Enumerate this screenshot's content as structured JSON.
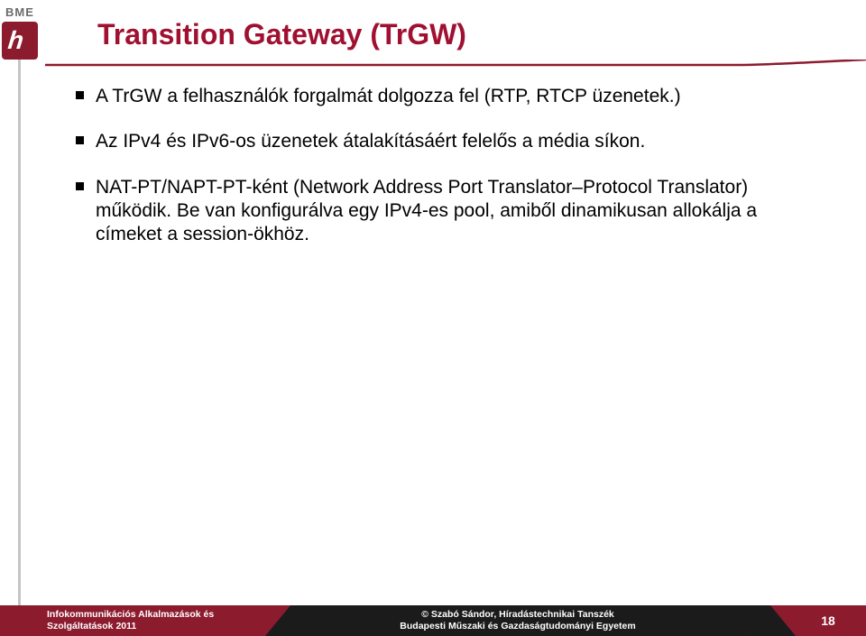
{
  "brand": {
    "rail_text": "BME",
    "rail_glyph": "h"
  },
  "title": "Transition Gateway (TrGW)",
  "bullets": [
    "A TrGW a felhasználók forgalmát dolgozza fel (RTP, RTCP üzenetek.)",
    "Az IPv4 és IPv6-os üzenetek átalakításáért felelős a média síkon.",
    "NAT-PT/NAPT-PT-ként (Network Address Port Translator–Protocol Translator) működik. Be van konfigurálva egy IPv4-es pool, amiből dinamikusan allokálja a címeket a session-ökhöz."
  ],
  "footer": {
    "left_line1": "Infokommunikációs Alkalmazások és",
    "left_line2": "Szolgáltatások 2011",
    "mid_line1": "© Szabó Sándor, Híradástechnikai Tanszék",
    "mid_line2": "Budapesti Műszaki és Gazdaságtudományi Egyetem",
    "page": "18"
  },
  "colors": {
    "accent": "#a01030",
    "brand": "#8c1b2e",
    "dark": "#1b1b1b"
  }
}
